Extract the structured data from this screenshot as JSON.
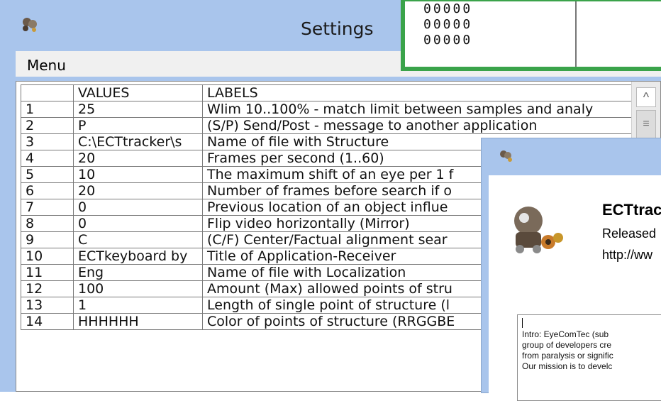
{
  "settings_window": {
    "title": "Settings",
    "menu_label": "Menu",
    "table": {
      "headers": [
        "",
        "VALUES",
        "LABELS"
      ],
      "rows": [
        [
          "1",
          "25",
          "Wlim 10..100% - match limit between samples and analy"
        ],
        [
          "2",
          "P",
          "(S/P) Send/Post - message to another application"
        ],
        [
          "3",
          "C:\\ECTtracker\\s",
          "Name of file with Structure"
        ],
        [
          "4",
          "20",
          "Frames per second (1..60)"
        ],
        [
          "5",
          "10",
          "The maximum shift of an eye per 1 f"
        ],
        [
          "6",
          "20",
          "Number of frames before search if o"
        ],
        [
          "7",
          "0",
          "Previous location of an object influe"
        ],
        [
          "8",
          "0",
          "Flip video horizontally (Mirror)"
        ],
        [
          "9",
          "C",
          "(C/F) Center/Factual alignment sear"
        ],
        [
          "10",
          "ECTkeyboard by",
          "Title of Application-Receiver"
        ],
        [
          "11",
          "Eng",
          "Name of file with Localization"
        ],
        [
          "12",
          "100",
          "Amount (Max) allowed points of stru"
        ],
        [
          "13",
          "1",
          "Length of single point of structure (l"
        ],
        [
          "14",
          "HHHHHH",
          "Color of points of structure (RRGGBE"
        ]
      ]
    },
    "scroll_up_glyph": "^",
    "scroll_thumb_glyph": "≡"
  },
  "green_window": {
    "lines": [
      "00000",
      "00000",
      "00000"
    ]
  },
  "about_window": {
    "title": "ECTtrac",
    "released": "Released",
    "url": "http://ww",
    "intro_lines": [
      "Intro: EyeComTec (sub",
      "group of developers cre",
      "from paralysis or signific",
      "Our mission is to develc"
    ]
  },
  "colors": {
    "window_frame": "#a9c5ec",
    "green_border": "#3aa34a"
  },
  "icons": [
    "app-robot-icon",
    "about-robot-icon",
    "robot-logo-icon",
    "scroll-up-icon"
  ]
}
